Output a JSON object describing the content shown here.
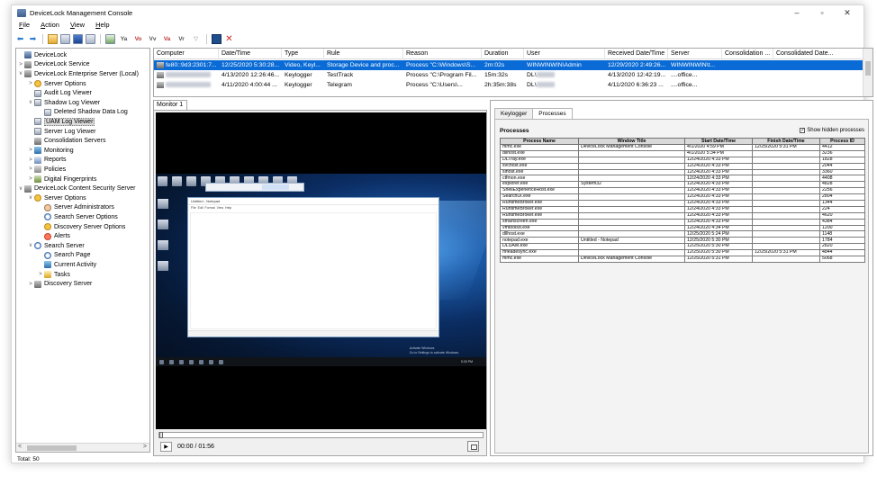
{
  "window": {
    "title": "DeviceLock Management Console",
    "controls": {
      "minimize": "–",
      "maximize": "▫",
      "close": "✕"
    }
  },
  "menu": [
    "File",
    "Action",
    "View",
    "Help"
  ],
  "toolbar": {
    "buttons": [
      "back-arrow",
      "forward-arrow",
      "up-folder",
      "show-hide-tree",
      "properties",
      "export-list",
      "refresh",
      "filter-a",
      "filter-b",
      "filter-c",
      "filter-d",
      "filter-e",
      "filter-off",
      "save",
      "delete"
    ],
    "filter_labels": [
      "Ya",
      "Vo",
      "Vv",
      "Va",
      "Vr",
      "▽"
    ]
  },
  "tree": [
    {
      "label": "DeviceLock",
      "level": 0,
      "expander": "",
      "icon": "pc"
    },
    {
      "label": "DeviceLock Service",
      "level": 0,
      "expander": ">",
      "icon": "srv"
    },
    {
      "label": "DeviceLock Enterprise Server (Local)",
      "level": 0,
      "expander": "v",
      "icon": "srv"
    },
    {
      "label": "Server Options",
      "level": 1,
      "expander": ">",
      "icon": "gear"
    },
    {
      "label": "Audit Log Viewer",
      "level": 1,
      "expander": "",
      "icon": "log"
    },
    {
      "label": "Shadow Log Viewer",
      "level": 1,
      "expander": "v",
      "icon": "log"
    },
    {
      "label": "Deleted Shadow Data Log",
      "level": 2,
      "expander": "",
      "icon": "log"
    },
    {
      "label": "UAM Log Viewer",
      "level": 1,
      "expander": "",
      "icon": "log",
      "selected": true
    },
    {
      "label": "Server Log Viewer",
      "level": 1,
      "expander": "",
      "icon": "log"
    },
    {
      "label": "Consolidation Servers",
      "level": 1,
      "expander": "",
      "icon": "srv"
    },
    {
      "label": "Monitoring",
      "level": 1,
      "expander": ">",
      "icon": "mon"
    },
    {
      "label": "Reports",
      "level": 1,
      "expander": ">",
      "icon": "rep"
    },
    {
      "label": "Policies",
      "level": 1,
      "expander": ">",
      "icon": "pol"
    },
    {
      "label": "Digital Fingerprints",
      "level": 1,
      "expander": ">",
      "icon": "fp"
    },
    {
      "label": "DeviceLock Content Security Server",
      "level": 0,
      "expander": "v",
      "icon": "srv"
    },
    {
      "label": "Server Options",
      "level": 1,
      "expander": "v",
      "icon": "gear"
    },
    {
      "label": "Server Administrators",
      "level": 2,
      "expander": "",
      "icon": "user"
    },
    {
      "label": "Search Server Options",
      "level": 2,
      "expander": "",
      "icon": "srch"
    },
    {
      "label": "Discovery Server Options",
      "level": 2,
      "expander": "",
      "icon": "gear"
    },
    {
      "label": "Alerts",
      "level": 2,
      "expander": "",
      "icon": "alert"
    },
    {
      "label": "Search Server",
      "level": 1,
      "expander": "v",
      "icon": "srch"
    },
    {
      "label": "Search Page",
      "level": 2,
      "expander": "",
      "icon": "srch"
    },
    {
      "label": "Current Activity",
      "level": 2,
      "expander": "",
      "icon": "mon"
    },
    {
      "label": "Tasks",
      "level": 2,
      "expander": ">",
      "icon": "task"
    },
    {
      "label": "Discovery Server",
      "level": 1,
      "expander": ">",
      "icon": "srv"
    }
  ],
  "grid": {
    "columns": [
      "Computer",
      "Date/Time",
      "Type",
      "Rule",
      "Reason",
      "Duration",
      "User",
      "Received Date/Time",
      "Server",
      "Consolidation ...",
      "Consolidated Date..."
    ],
    "rows": [
      {
        "selected": true,
        "cells": [
          "fe80::9d3:2301:7...",
          "12/25/2020 5:30:28...",
          "Video, Keyl...",
          "Storage Device and proc...",
          "Process \"C:\\Windows\\S...",
          "2m:02s",
          "WINWINWIN\\Admin",
          "12/29/2020 2:49:26...",
          "WINWINWIN\\t...",
          "",
          ""
        ]
      },
      {
        "selected": false,
        "cells": [
          "",
          "4/13/2020 12:26:46...",
          "Keylogger",
          "TestTrack",
          "Process \"C:\\Program Fil...",
          "15m:32s",
          "DL\\",
          "4/13/2020 12:42:19...",
          "....office...",
          "",
          ""
        ]
      },
      {
        "selected": false,
        "cells": [
          "",
          "4/11/2020 4:00:44 ...",
          "Keylogger",
          "Telegram",
          "Process \"C:\\Users\\...",
          "2h:35m:38s",
          "DL\\",
          "4/11/2020 6:36:23 ...",
          "....office...",
          "",
          ""
        ]
      }
    ]
  },
  "monitor": {
    "tab": "Monitor 1",
    "time": "00:00 / 01:56",
    "activate_text": "Activate Windows\nGo to Settings to activate Windows."
  },
  "details": {
    "tabs": [
      "Keylogger",
      "Processes"
    ],
    "active_tab": "Processes",
    "section_label": "Processes",
    "show_hidden_label": "Show hidden processes",
    "show_hidden_checked": true,
    "columns": [
      "Process Name",
      "Window Title",
      "Start Date/Time",
      "Finish Date/Time",
      "Process ID"
    ],
    "rows": [
      [
        "mmc.exe",
        "DeviceLock Management Console",
        "4/1/2020 4:59 PM",
        "12/25/2020 5:31 PM",
        "4412"
      ],
      [
        "dllhost.exe",
        "",
        "4/1/2020 5:34 PM",
        "",
        "3236"
      ],
      [
        "DLTray.exe",
        "",
        "12/24/2020 4:33 PM",
        "",
        "1828"
      ],
      [
        "svchost.exe",
        "",
        "12/24/2020 4:33 PM",
        "",
        "2044"
      ],
      [
        "sihost.exe",
        "",
        "12/24/2020 4:33 PM",
        "",
        "3360"
      ],
      [
        "ctfmon.exe",
        "",
        "12/24/2020 4:33 PM",
        "",
        "4408"
      ],
      [
        "explorer.exe",
        "System32",
        "12/24/2020 4:33 PM",
        "",
        "4828"
      ],
      [
        "ShellExperienceHost.exe",
        "",
        "12/24/2020 4:33 PM",
        "",
        "2256"
      ],
      [
        "SearchUI.exe",
        "",
        "12/24/2020 4:33 PM",
        "",
        "2804"
      ],
      [
        "RuntimeBroker.exe",
        "",
        "12/24/2020 4:33 PM",
        "",
        "1344"
      ],
      [
        "RuntimeBroker.exe",
        "",
        "12/24/2020 4:33 PM",
        "",
        "224"
      ],
      [
        "RuntimeBroker.exe",
        "",
        "12/24/2020 4:33 PM",
        "",
        "4620"
      ],
      [
        "smartscreen.exe",
        "",
        "12/24/2020 4:33 PM",
        "",
        "4384"
      ],
      [
        "vmtoolsd.exe",
        "",
        "12/24/2020 4:34 PM",
        "",
        "1200"
      ],
      [
        "dllhost.exe",
        "",
        "12/25/2020 5:24 PM",
        "",
        "1148"
      ],
      [
        "notepad.exe",
        "Untitled - Notepad",
        "12/25/2020 5:30 PM",
        "",
        "1784"
      ],
      [
        "DLUAM.exe",
        "",
        "12/25/2020 5:30 PM",
        "",
        "2820"
      ],
      [
        "mfeadesync.exe",
        "",
        "12/25/2020 5:30 PM",
        "12/25/2020 5:31 PM",
        "4844"
      ],
      [
        "mmc.exe",
        "DeviceLock Management Console",
        "12/25/2020 5:31 PM",
        "",
        "5068"
      ]
    ]
  },
  "status_bar": "Total: 50"
}
